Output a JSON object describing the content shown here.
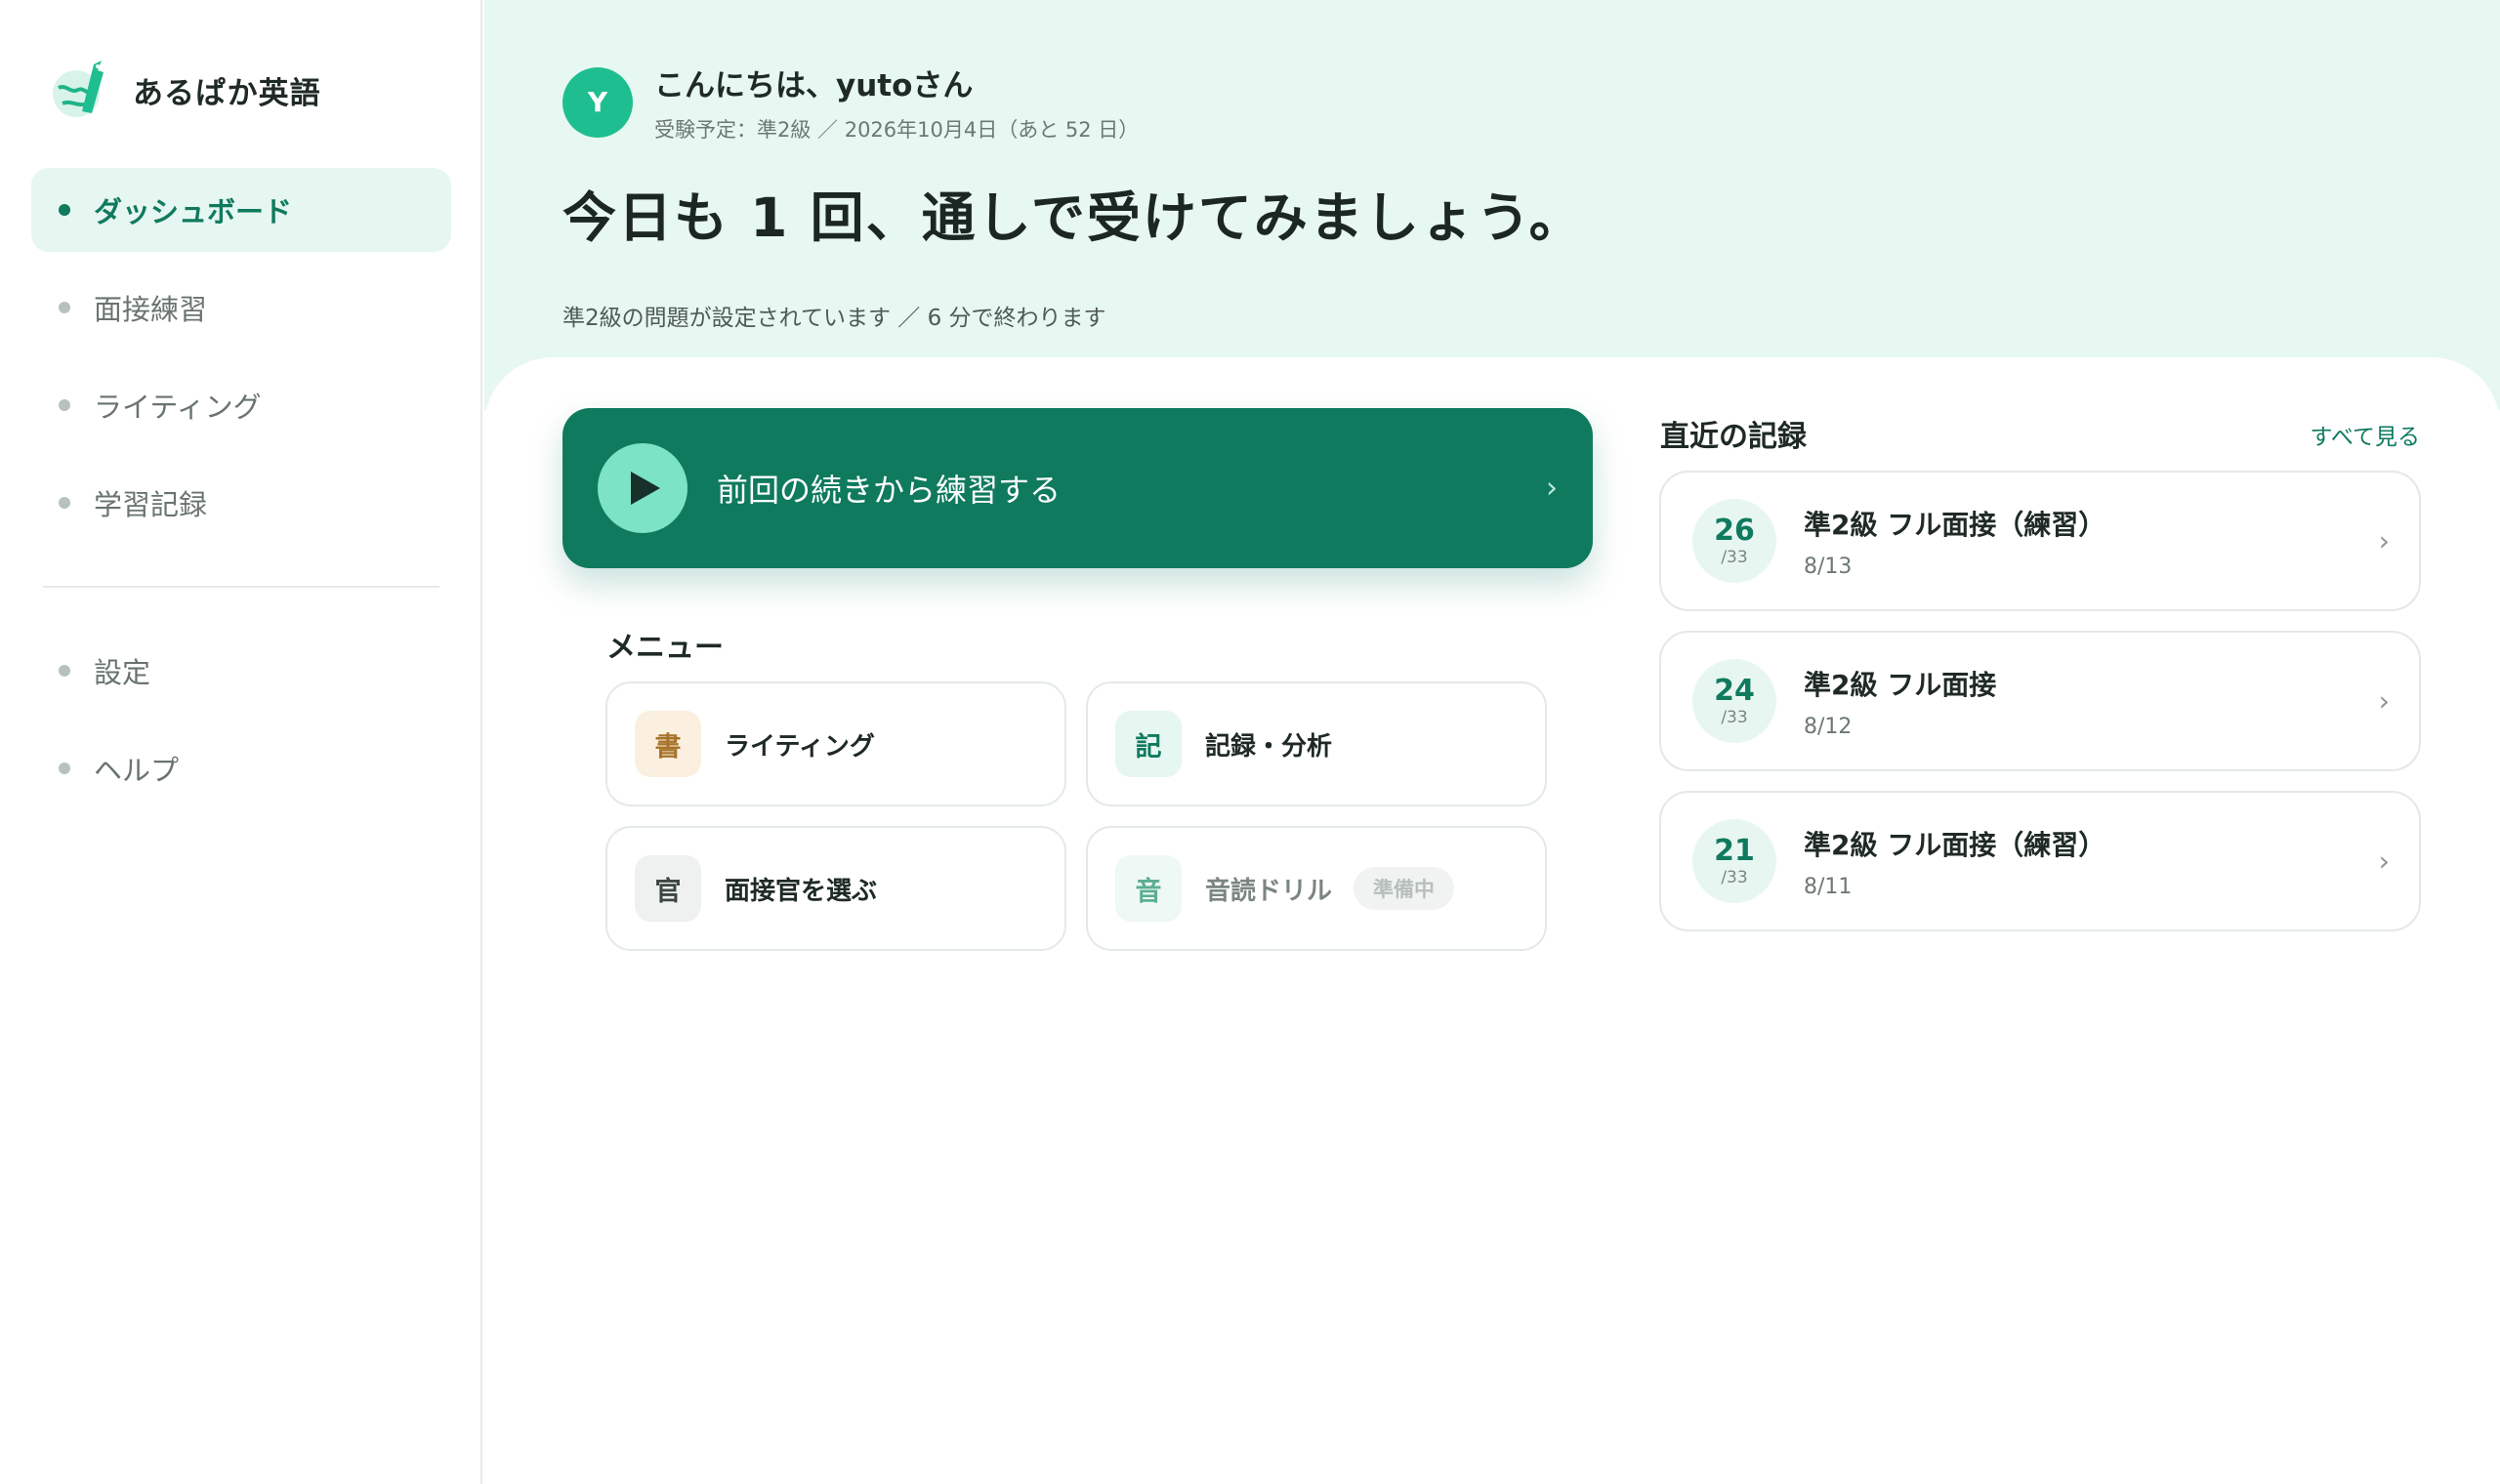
{
  "brand": {
    "name": "あるぱか英語"
  },
  "nav": {
    "items": [
      {
        "label": "ダッシュボード",
        "active": true
      },
      {
        "label": "面接練習",
        "active": false
      },
      {
        "label": "ライティング",
        "active": false
      },
      {
        "label": "学習記録",
        "active": false
      }
    ],
    "secondary": [
      {
        "label": "設定"
      },
      {
        "label": "ヘルプ"
      }
    ]
  },
  "header": {
    "avatar_initial": "Y",
    "greeting": "こんにちは、yutoさん",
    "exam_info": "受験予定：準2級 ／ 2026年10月4日（あと 52 日）",
    "headline": "今日も 1 回、通しで受けてみましょう。",
    "note": "準2級の問題が設定されています ／ 6 分で終わります"
  },
  "cta": {
    "label": "前回の続きから練習する",
    "chevron": "›"
  },
  "menu": {
    "title": "メニュー",
    "items": [
      {
        "icon_char": "書",
        "label": "ライティング",
        "icon_bg": "#fbf0e0",
        "icon_color": "#a8732a",
        "disabled": false,
        "badge": ""
      },
      {
        "icon_char": "記",
        "label": "記録・分析",
        "icon_bg": "#e6f6f0",
        "icon_color": "#0f7a5e",
        "disabled": false,
        "badge": ""
      },
      {
        "icon_char": "官",
        "label": "面接官を選ぶ",
        "icon_bg": "#eef1f0",
        "icon_color": "#3d4643",
        "disabled": false,
        "badge": ""
      },
      {
        "icon_char": "音",
        "label": "音読ドリル",
        "icon_bg": "#eef8f4",
        "icon_color": "#5cae95",
        "disabled": true,
        "badge": "準備中"
      }
    ]
  },
  "records": {
    "title": "直近の記録",
    "see_all": "すべて見る",
    "items": [
      {
        "score": "26",
        "max": "/33",
        "name": "準2級 フル面接（練習）",
        "date": "8/13"
      },
      {
        "score": "24",
        "max": "/33",
        "name": "準2級 フル面接",
        "date": "8/12"
      },
      {
        "score": "21",
        "max": "/33",
        "name": "準2級 フル面接（練習）",
        "date": "8/11"
      }
    ]
  },
  "colors": {
    "accent": "#0f7a5e",
    "accent_light": "#7ce3c6",
    "hero_bg": "#e7f7f1",
    "avatar": "#1fbe91"
  },
  "icons": {
    "logo": "alpaca-globe-logo",
    "cta": "play-icon",
    "chevron": "chevron-right-icon"
  }
}
